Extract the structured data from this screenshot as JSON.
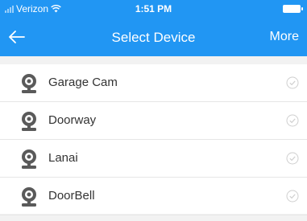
{
  "status_bar": {
    "carrier": "Verizon",
    "time": "1:51 PM"
  },
  "nav": {
    "title": "Select Device",
    "more_label": "More"
  },
  "devices": [
    {
      "label": "Garage Cam"
    },
    {
      "label": "Doorway"
    },
    {
      "label": "Lanai"
    },
    {
      "label": "DoorBell"
    }
  ],
  "colors": {
    "accent": "#2196f3",
    "background": "#f2f2f2",
    "text": "#333333"
  },
  "icons": {
    "back": "arrow-left-icon",
    "device": "camera-icon",
    "select": "check-circle-icon"
  }
}
